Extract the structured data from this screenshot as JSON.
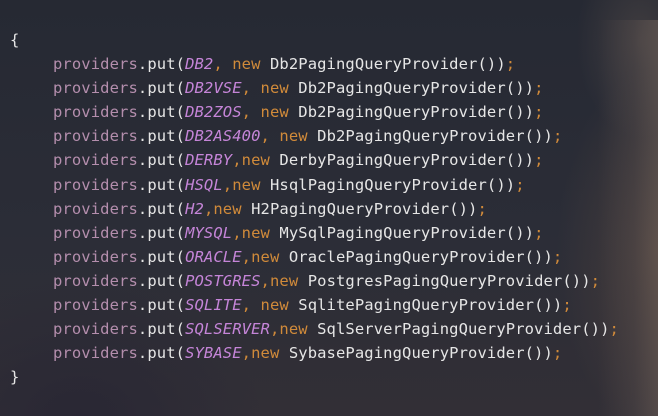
{
  "editor": {
    "open_brace": "{",
    "close_brace": "}",
    "object_name": "providers",
    "dot": ".",
    "method": "put",
    "open_paren": "(",
    "keyword_new": "new",
    "call_close": "());",
    "colors": {
      "background": "#2a2c36",
      "object": "#b48ead",
      "constant": "#c585d8",
      "keyword": "#d08a3a",
      "text": "#e6e6e6"
    },
    "lines": [
      {
        "constant": "DB2",
        "separator": ", ",
        "class_name": "Db2PagingQueryProvider"
      },
      {
        "constant": "DB2VSE",
        "separator": ", ",
        "class_name": "Db2PagingQueryProvider"
      },
      {
        "constant": "DB2ZOS",
        "separator": ", ",
        "class_name": "Db2PagingQueryProvider"
      },
      {
        "constant": "DB2AS400",
        "separator": ", ",
        "class_name": "Db2PagingQueryProvider"
      },
      {
        "constant": "DERBY",
        "separator": ",",
        "class_name": "DerbyPagingQueryProvider"
      },
      {
        "constant": "HSQL",
        "separator": ",",
        "class_name": "HsqlPagingQueryProvider"
      },
      {
        "constant": "H2",
        "separator": ",",
        "class_name": "H2PagingQueryProvider"
      },
      {
        "constant": "MYSQL",
        "separator": ",",
        "class_name": "MySqlPagingQueryProvider"
      },
      {
        "constant": "ORACLE",
        "separator": ",",
        "class_name": "OraclePagingQueryProvider"
      },
      {
        "constant": "POSTGRES",
        "separator": ",",
        "class_name": "PostgresPagingQueryProvider"
      },
      {
        "constant": "SQLITE",
        "separator": ", ",
        "class_name": "SqlitePagingQueryProvider"
      },
      {
        "constant": "SQLSERVER",
        "separator": ",",
        "class_name": "SqlServerPagingQueryProvider"
      },
      {
        "constant": "SYBASE",
        "separator": ",",
        "class_name": "SybasePagingQueryProvider"
      }
    ]
  }
}
